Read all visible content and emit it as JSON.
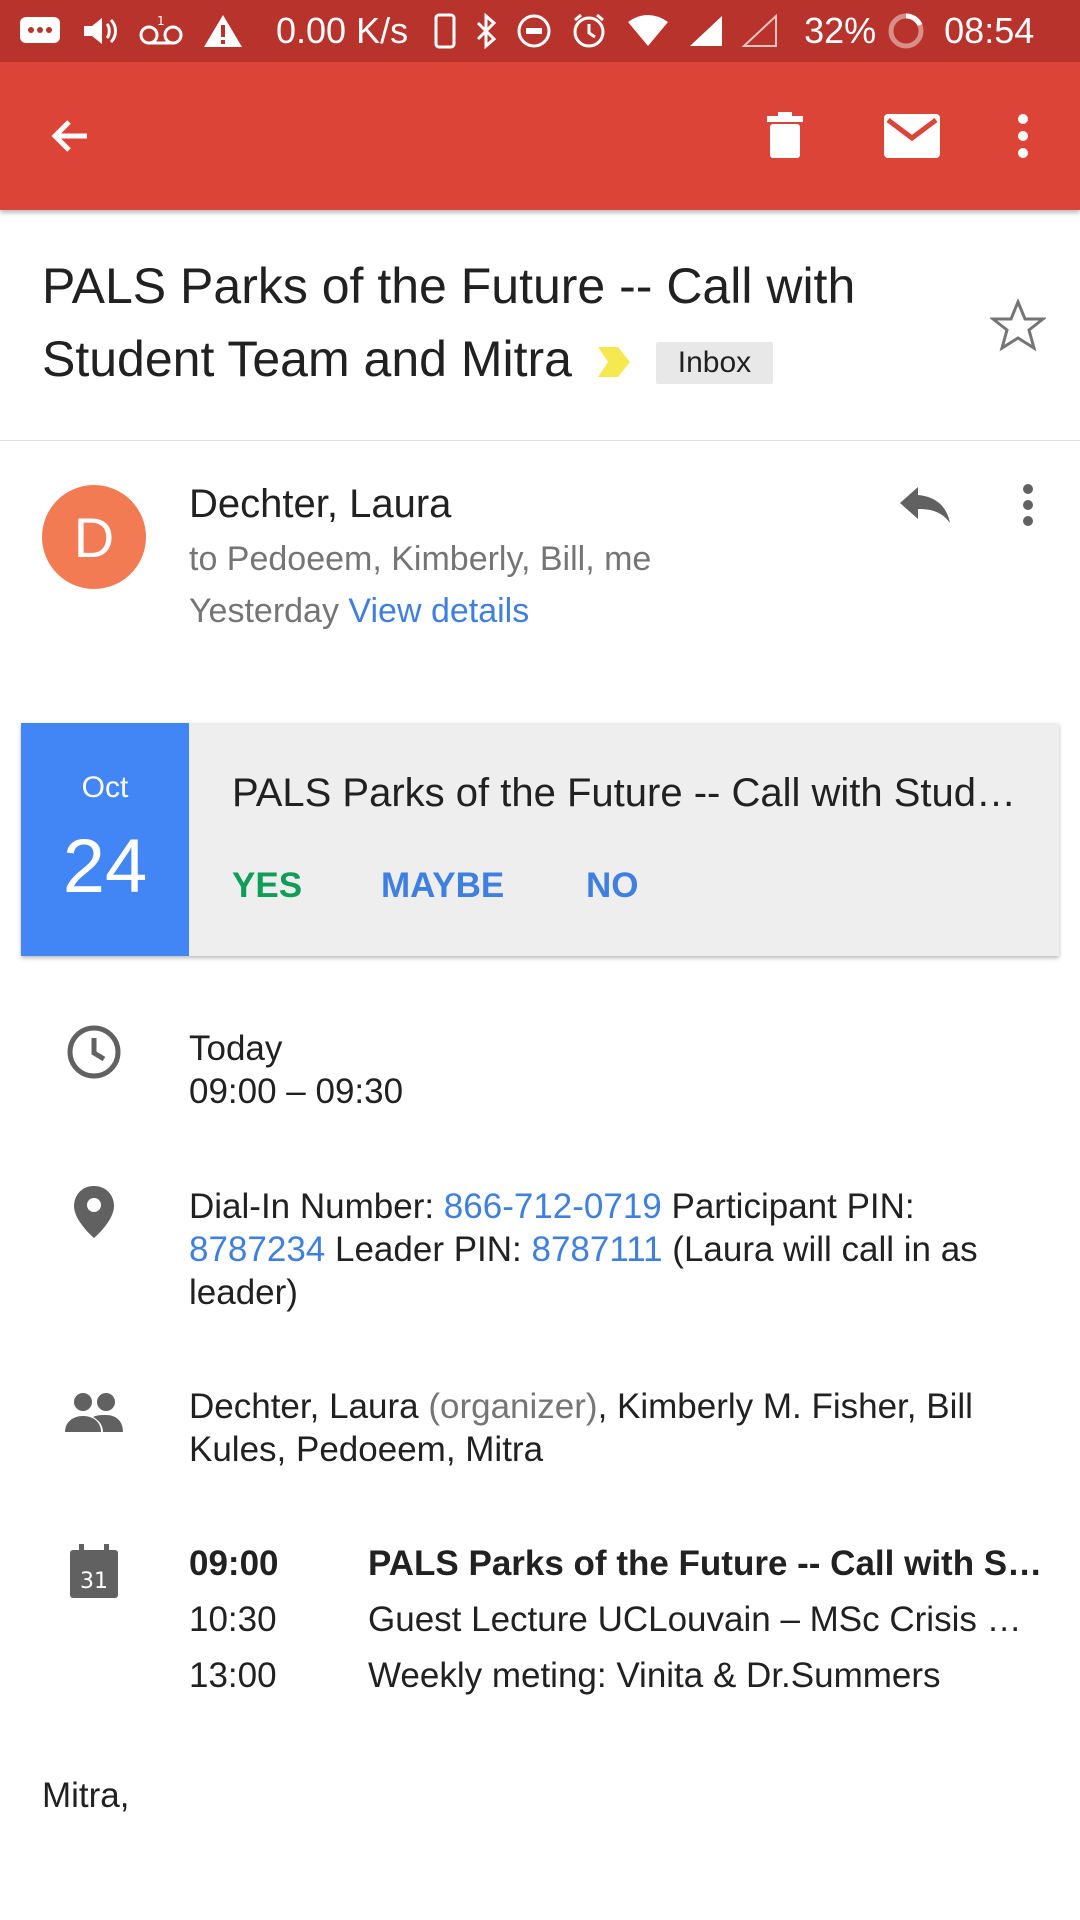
{
  "status_bar": {
    "speed": "0.00 K/s",
    "battery": "32%",
    "time": "08:54"
  },
  "app_bar": {
    "back_icon": "arrow-back-icon",
    "delete_icon": "trash-icon",
    "mark_unread_icon": "mail-icon",
    "more_icon": "more-vert-icon",
    "background_color": "#db4437"
  },
  "email": {
    "subject": "PALS Parks of the Future -- Call with Student Team and Mitra",
    "label": "Inbox",
    "sender": {
      "initial": "D",
      "name": "Dechter, Laura",
      "recipients": "to Pedoeem, Kimberly, Bill, me",
      "date": "Yesterday",
      "view_details": "View details",
      "avatar_color": "#f37b53"
    },
    "invite": {
      "month": "Oct",
      "day": "24",
      "title": "PALS Parks of the Future -- Call with Student Team and Mitra",
      "yes": "YES",
      "maybe": "MAYBE",
      "no": "NO"
    },
    "when": {
      "day": "Today",
      "range": "09:00 – 09:30"
    },
    "location": {
      "dial_label": "Dial-In Number: ",
      "dial_number": "866-712-0719",
      "participant_label": " Participant PIN: ",
      "participant_pin": "8787234",
      "leader_label": " Leader PIN: ",
      "leader_pin": "8787111",
      "note": " (Laura will call in as leader)"
    },
    "guests": {
      "organizer_name": "Dechter, Laura",
      "organizer_tag": "(organizer)",
      "others": ", Kimberly M. Fisher, Bill Kules, Pedoeem, Mitra"
    },
    "agenda": {
      "calendar_icon_day": "31",
      "items": [
        {
          "time": "09:00",
          "title": "PALS Parks of the Future -- Call with Student Team and Mitra"
        },
        {
          "time": "10:30",
          "title": "Guest Lecture UCLouvain – MSc Crisis Management"
        },
        {
          "time": "13:00",
          "title": "Weekly meting: Vinita & Dr.Summers"
        }
      ]
    },
    "body_start": "Mitra,"
  }
}
